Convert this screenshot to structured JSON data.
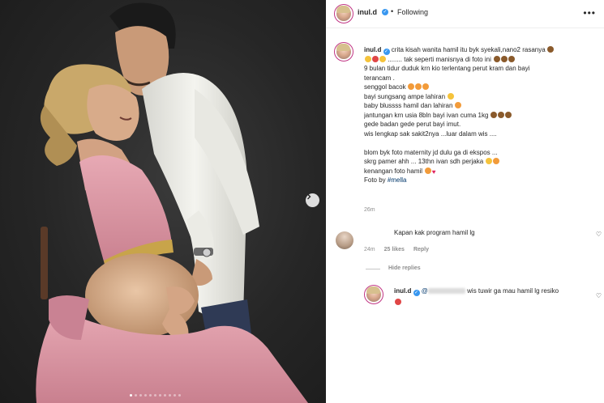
{
  "header": {
    "username": "inul.d",
    "follow_label": "Following",
    "more_label": "•••"
  },
  "media": {
    "carousel_count": 11,
    "active_index": 0
  },
  "caption": {
    "username": "inul.d",
    "lines": [
      "crita kisah wanita hamil itu byk syekali,nano2 rasanya",
      "........ tak seperti manisnya di foto ini",
      "9 bulan tidur duduk  krn kio terlentang perut kram dan bayi",
      "terancam .",
      "senggol bacok",
      "bayi sungsang ampe lahiran",
      "baby blussss hamil dan lahiran",
      "jantungan krn usia 8bln bayi ivan cuma 1kg",
      "gede badan gede perut bayi imut.",
      "wis lengkap sak sakit2nya ...luar dalam wis ....",
      "",
      "blom byk foto maternity jd dulu ga di ekspos ...",
      "skrg pamer ahh ... 13thn ivan sdh perjaka",
      "kenangan foto hamil",
      "Foto by"
    ],
    "photo_credit_tag": "#mella",
    "time_ago": "26m"
  },
  "comment": {
    "text": "Kapan kak program hamil lg",
    "time_ago": "24m",
    "likes": "25 likes",
    "reply_label": "Reply",
    "hide_replies_label": "Hide replies"
  },
  "reply": {
    "username": "inul.d",
    "mention_prefix": "@",
    "text": "wis tuwir ga mau hamil lg resiko"
  },
  "colors": {
    "link": "#00376b",
    "muted": "#8e8e8e",
    "verified": "#3897f0",
    "dress_pink": "#e3a1ad"
  }
}
